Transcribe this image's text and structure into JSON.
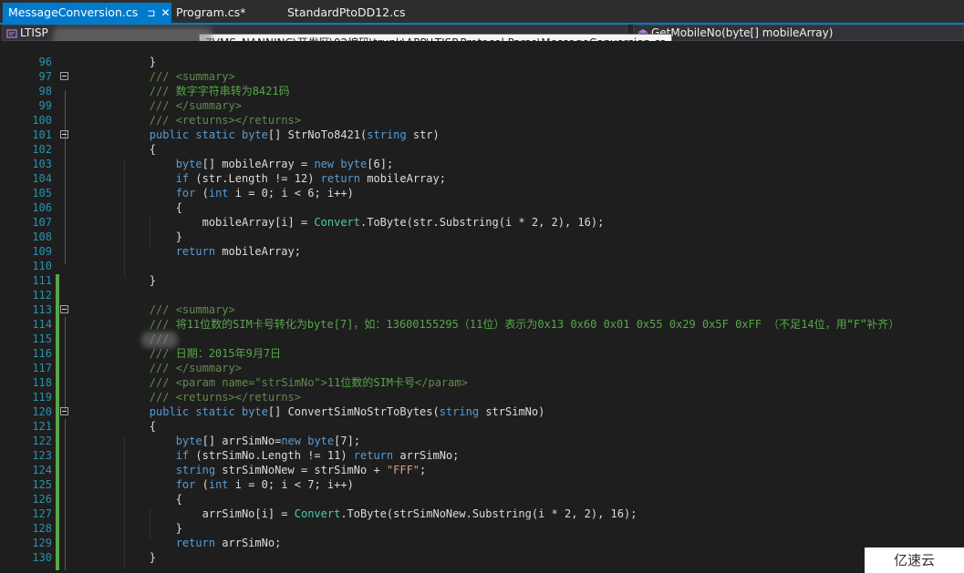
{
  "tabs": [
    {
      "label": "MessageConversion.cs",
      "pin": "⊐",
      "close": "✕",
      "active": true
    },
    {
      "label": "Program.cs*",
      "active": false
    },
    {
      "label": "StandardPtoDD12.cs",
      "active": false
    }
  ],
  "nav": {
    "left_label": "LTISP",
    "right_label": "GetMobileNo(byte[] mobileArray)"
  },
  "tooltip": {
    "path": "7VMS_NANNING\\开发区\\02编码\\trunk\\APP\\LTISP.Protocol.Parse\\MessageConversion.cs"
  },
  "editor": {
    "lines": [
      {
        "n": "96",
        "code": "        }"
      },
      {
        "n": "97",
        "code": "        /// <summary>"
      },
      {
        "n": "98",
        "code": "        /// 数字字符串转为8421码"
      },
      {
        "n": "99",
        "code": "        /// </summary>"
      },
      {
        "n": "100",
        "code": "        /// <returns></returns>"
      },
      {
        "n": "101",
        "code": "        public static byte[] StrNoTo8421(string str)"
      },
      {
        "n": "102",
        "code": "        {"
      },
      {
        "n": "103",
        "code": "            byte[] mobileArray = new byte[6];"
      },
      {
        "n": "104",
        "code": "            if (str.Length != 12) return mobileArray;"
      },
      {
        "n": "105",
        "code": "            for (int i = 0; i < 6; i++)"
      },
      {
        "n": "106",
        "code": "            {"
      },
      {
        "n": "107",
        "code": "                mobileArray[i] = Convert.ToByte(str.Substring(i * 2, 2), 16);"
      },
      {
        "n": "108",
        "code": "            }"
      },
      {
        "n": "109",
        "code": "            return mobileArray;"
      },
      {
        "n": "110",
        "code": ""
      },
      {
        "n": "111",
        "code": "        }"
      },
      {
        "n": "112",
        "code": ""
      },
      {
        "n": "113",
        "code": "        /// <summary>"
      },
      {
        "n": "114",
        "code": "        /// 将11位数的SIM卡号转化为byte[7]，如：13600155295（11位）表示为0x13 0x60 0x01 0x55 0x29 0x5F 0xFF （不足14位，用“F”补齐）"
      },
      {
        "n": "115",
        "code": "        ///"
      },
      {
        "n": "116",
        "code": "        /// 日期：2015年9月7日"
      },
      {
        "n": "117",
        "code": "        /// </summary>"
      },
      {
        "n": "118",
        "code": "        /// <param name=\"strSimNo\">11位数的SIM卡号</param>"
      },
      {
        "n": "119",
        "code": "        /// <returns></returns>"
      },
      {
        "n": "120",
        "code": "        public static byte[] ConvertSimNoStrToBytes(string strSimNo)"
      },
      {
        "n": "121",
        "code": "        {"
      },
      {
        "n": "122",
        "code": "            byte[] arrSimNo=new byte[7];"
      },
      {
        "n": "123",
        "code": "            if (strSimNo.Length != 11) return arrSimNo;"
      },
      {
        "n": "124",
        "code": "            string strSimNoNew = strSimNo + \"FFF\";"
      },
      {
        "n": "125",
        "code": "            for (int i = 0; i < 7; i++)"
      },
      {
        "n": "126",
        "code": "            {"
      },
      {
        "n": "127",
        "code": "                arrSimNo[i] = Convert.ToByte(strSimNoNew.Substring(i * 2, 2), 16);"
      },
      {
        "n": "128",
        "code": "            }"
      },
      {
        "n": "129",
        "code": "            return arrSimNo;"
      },
      {
        "n": "130",
        "code": "        }"
      }
    ]
  },
  "watermark": {
    "text": "亿速云"
  },
  "colors": {
    "accent": "#007acc",
    "keyword": "#569cd6",
    "type": "#4ec9b0",
    "comment": "#57a64a",
    "string": "#d69d85",
    "line_number": "#2b91af",
    "editor_bg": "#1e1e1e"
  }
}
